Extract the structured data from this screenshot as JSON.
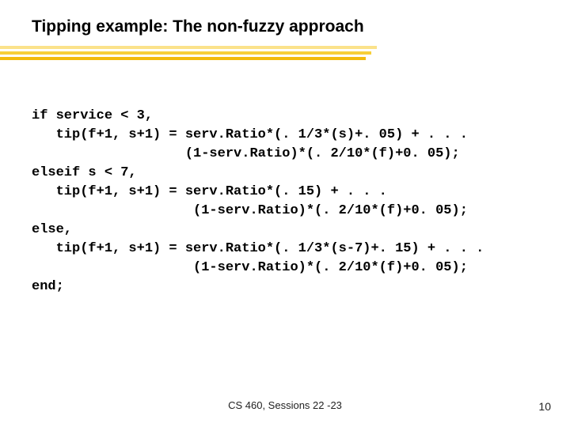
{
  "title": "Tipping example:  The non-fuzzy approach",
  "code": {
    "l1": "if service < 3,",
    "l2": "   tip(f+1, s+1) = serv.Ratio*(. 1/3*(s)+. 05) + . . .",
    "l3": "                   (1-serv.Ratio)*(. 2/10*(f)+0. 05);",
    "l4": "elseif s < 7,",
    "l5": "   tip(f+1, s+1) = serv.Ratio*(. 15) + . . .",
    "l6": "                    (1-serv.Ratio)*(. 2/10*(f)+0. 05);",
    "l7": "else,",
    "l8": "   tip(f+1, s+1) = serv.Ratio*(. 1/3*(s-7)+. 15) + . . .",
    "l9": "                    (1-serv.Ratio)*(. 2/10*(f)+0. 05);",
    "l10": "end;"
  },
  "footer": "CS 460,  Sessions 22 -23",
  "page_number": "10"
}
